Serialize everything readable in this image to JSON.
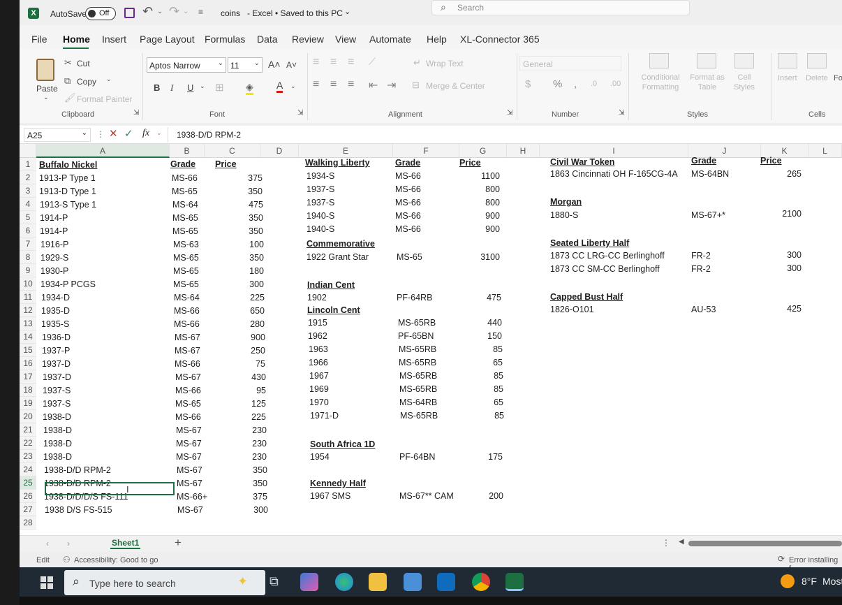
{
  "title_bar": {
    "autosave_label": "AutoSave",
    "autosave_state": "Off",
    "filename": "coins",
    "status": "-  Excel  •  Saved to this PC",
    "search_placeholder": "Search"
  },
  "menu": [
    "File",
    "Home",
    "Insert",
    "Page Layout",
    "Formulas",
    "Data",
    "Review",
    "View",
    "Automate",
    "Help",
    "XL-Connector 365"
  ],
  "ribbon": {
    "paste": "Paste",
    "cut": "Cut",
    "copy": "Copy",
    "format_painter": "Format Painter",
    "clipboard": "Clipboard",
    "font_name": "Aptos Narrow",
    "font_size": "11",
    "font": "Font",
    "wrap_text": "Wrap Text",
    "merge_center": "Merge & Center",
    "alignment": "Alignment",
    "number_format": "General",
    "number": "Number",
    "conditional_formatting": "Conditional Formatting",
    "format_as_table": "Format as Table",
    "cell_styles": "Cell Styles",
    "styles": "Styles",
    "insert": "Insert",
    "delete": "Delete",
    "format_partial": "Fo",
    "cells": "Cells"
  },
  "formula_bar": {
    "name_box": "A25",
    "content": "1938-D/D RPM-2"
  },
  "columns": [
    "A",
    "B",
    "C",
    "D",
    "E",
    "F",
    "G",
    "H",
    "I",
    "J",
    "K",
    "L"
  ],
  "sheet": {
    "table_a": {
      "header": [
        "Buffalo Nickel",
        "Grade",
        "Price"
      ],
      "rows": [
        [
          "1913-P Type 1",
          "MS-66",
          "375"
        ],
        [
          "1913-D Type 1",
          "MS-65",
          "350"
        ],
        [
          "1913-S Type 1",
          "MS-64",
          "475"
        ],
        [
          "1914-P",
          "MS-65",
          "350"
        ],
        [
          "1914-P",
          "MS-65",
          "350"
        ],
        [
          "1916-P",
          "MS-63",
          "100"
        ],
        [
          "1929-S",
          "MS-65",
          "350"
        ],
        [
          "1930-P",
          "MS-65",
          "180"
        ],
        [
          "1934-P PCGS",
          "MS-65",
          "300"
        ],
        [
          "1934-D",
          "MS-64",
          "225"
        ],
        [
          "1935-D",
          "MS-66",
          "650"
        ],
        [
          "1935-S",
          "MS-66",
          "280"
        ],
        [
          "1936-D",
          "MS-67",
          "900"
        ],
        [
          "1937-P",
          "MS-67",
          "250"
        ],
        [
          "1937-D",
          "MS-66",
          "75"
        ],
        [
          "1937-D",
          "MS-67",
          "430"
        ],
        [
          "1937-S",
          "MS-66",
          "95"
        ],
        [
          "1937-S",
          "MS-65",
          "125"
        ],
        [
          "1938-D",
          "MS-66",
          "225"
        ],
        [
          "1938-D",
          "MS-67",
          "230"
        ],
        [
          "1938-D",
          "MS-67",
          "230"
        ],
        [
          "1938-D",
          "MS-67",
          "230"
        ],
        [
          "1938-D/D RPM-2",
          "MS-67",
          "350"
        ],
        [
          "1938-D/D RPM-2",
          "MS-67",
          "350"
        ],
        [
          "1938-D/D/D/S FS-111",
          "MS-66+",
          "375"
        ],
        [
          "1938 D/S FS-515",
          "MS-67",
          "300"
        ]
      ]
    },
    "table_e": {
      "header": [
        "Walking Liberty",
        "Grade",
        "Price"
      ],
      "walking_rows": [
        [
          "1934-S",
          "MS-66",
          "1100"
        ],
        [
          "1937-S",
          "MS-66",
          "800"
        ],
        [
          "1937-S",
          "MS-66",
          "800"
        ],
        [
          "1940-S",
          "MS-66",
          "900"
        ],
        [
          "1940-S",
          "MS-66",
          "900"
        ]
      ],
      "commemorative": "Commemorative",
      "commemorative_row": [
        "1922 Grant Star",
        "MS-65",
        "3100"
      ],
      "indian_cent": "Indian Cent",
      "indian_row": [
        "1902",
        "PF-64RB",
        "475"
      ],
      "lincoln_cent": "Lincoln Cent",
      "lincoln_rows": [
        [
          "1915",
          "MS-65RB",
          "440"
        ],
        [
          "1962",
          "PF-65BN",
          "150"
        ],
        [
          "1963",
          "MS-65RB",
          "85"
        ],
        [
          "1966",
          "MS-65RB",
          "65"
        ],
        [
          "1967",
          "MS-65RB",
          "85"
        ],
        [
          "1969",
          "MS-65RB",
          "85"
        ],
        [
          "1970",
          "MS-64RB",
          "65"
        ],
        [
          "1971-D",
          "MS-65RB",
          "85"
        ]
      ],
      "south_africa": "South Africa 1D",
      "south_africa_row": [
        "1954",
        "PF-64BN",
        "175"
      ],
      "kennedy": "Kennedy Half",
      "kennedy_row": [
        "1967 SMS",
        "MS-67** CAM",
        "200"
      ]
    },
    "table_i": {
      "header": [
        "Civil War Token",
        "Grade",
        "Price"
      ],
      "civil_row": [
        "1863 Cincinnati OH F-165CG-4A",
        "MS-64BN",
        "265"
      ],
      "morgan": "Morgan",
      "morgan_row": [
        "1880-S",
        "MS-67+*",
        "2100"
      ],
      "seated": "Seated Liberty Half",
      "seated_rows": [
        [
          "1873 CC LRG-CC Berlinghoff",
          "FR-2",
          "300"
        ],
        [
          "1873 CC SM-CC Berlinghoff",
          "FR-2",
          "300"
        ]
      ],
      "capped": "Capped Bust Half",
      "capped_row": [
        "1826-O101",
        "AU-53",
        "425"
      ]
    }
  },
  "sheet_tab": "Sheet1",
  "status_bar": {
    "mode": "Edit",
    "accessibility": "Accessibility: Good to go",
    "error": "Error installing f"
  },
  "taskbar": {
    "search_placeholder": "Type here to search",
    "weather": "8°F",
    "weather_desc": "Most"
  }
}
